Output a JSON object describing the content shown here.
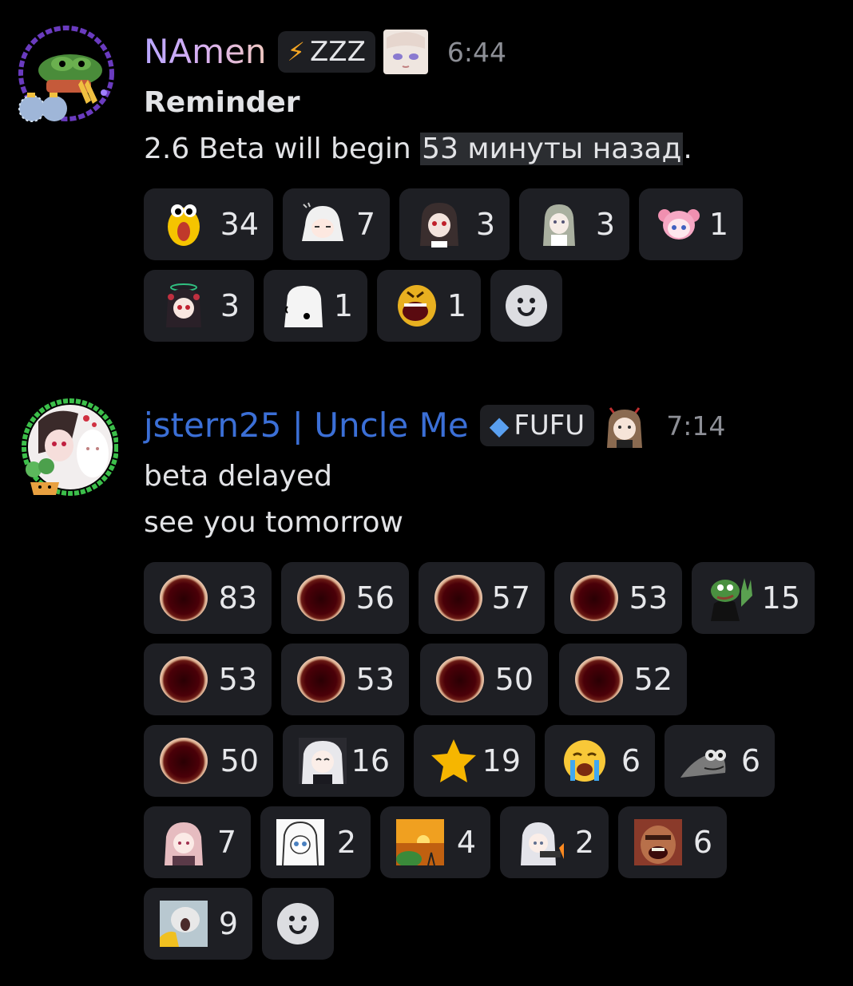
{
  "messages": [
    {
      "username": "NAmen",
      "username_color": "#c9a6f0",
      "tag": {
        "icon": "lightning-icon",
        "icon_char": "⚡",
        "label": "ZZZ"
      },
      "role_icon": "anime-girl-icon",
      "timestamp": "6:44",
      "lines": {
        "title": "Reminder",
        "body_prefix": "2.6 Beta will begin ",
        "body_highlight": "53 минуты назад",
        "body_suffix": "."
      },
      "reactions": [
        {
          "emoji": "surprised-chick-emoji",
          "count": "34"
        },
        {
          "emoji": "white-hair-girl-emoji",
          "count": "7"
        },
        {
          "emoji": "dark-hair-girl-emoji",
          "count": "3"
        },
        {
          "emoji": "maid-girl-emoji",
          "count": "3"
        },
        {
          "emoji": "pink-hair-girl-emoji",
          "count": "1"
        },
        {
          "emoji": "halo-girl-emoji",
          "count": "3"
        },
        {
          "emoji": "white-blob-emoji",
          "count": "1"
        },
        {
          "emoji": "screaming-face-emoji",
          "count": "1"
        }
      ]
    },
    {
      "username": "jstern25 | Uncle Me",
      "username_color": "#3b6fd6",
      "tag": {
        "icon": "diamond-icon",
        "icon_char": "◆",
        "label": "FUFU"
      },
      "role_icon": "horned-girl-icon",
      "timestamp": "7:14",
      "lines": {
        "line1": "beta delayed",
        "line2": "see you tomorrow"
      },
      "reactions": [
        {
          "emoji": "hole-emoji",
          "count": "83"
        },
        {
          "emoji": "hole-emoji",
          "count": "56"
        },
        {
          "emoji": "hole-emoji",
          "count": "57"
        },
        {
          "emoji": "hole-emoji",
          "count": "53"
        },
        {
          "emoji": "pepe-suit-emoji",
          "count": "15"
        },
        {
          "emoji": "hole-emoji",
          "count": "53"
        },
        {
          "emoji": "hole-emoji",
          "count": "53"
        },
        {
          "emoji": "hole-emoji",
          "count": "50"
        },
        {
          "emoji": "hole-emoji",
          "count": "52"
        },
        {
          "emoji": "hole-emoji",
          "count": "50"
        },
        {
          "emoji": "anime-girl-emoji",
          "count": "16"
        },
        {
          "emoji": "star-emoji",
          "count": "19"
        },
        {
          "emoji": "crying-face-emoji",
          "count": "6"
        },
        {
          "emoji": "frog-peek-emoji",
          "count": "6"
        },
        {
          "emoji": "hooded-girl-emoji",
          "count": "7"
        },
        {
          "emoji": "sketch-girl-emoji",
          "count": "2"
        },
        {
          "emoji": "sunset-frog-emoji",
          "count": "4"
        },
        {
          "emoji": "gun-girl-emoji",
          "count": "2"
        },
        {
          "emoji": "laughing-man-emoji",
          "count": "6"
        },
        {
          "emoji": "screaming-cat-emoji",
          "count": "9"
        }
      ]
    }
  ],
  "colors": {
    "accent_gold": "#f5c400",
    "reaction_bg": "#1e1f24",
    "hole_inner": "#3a0004",
    "hole_rim": "#e8c2a8"
  }
}
